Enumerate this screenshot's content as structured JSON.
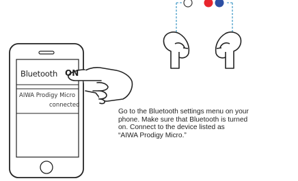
{
  "phone": {
    "bluetooth_label": "Bluetooth",
    "bluetooth_status": "ON",
    "device_name": "AIWA Prodigy Micro",
    "device_status": "connected"
  },
  "instructions": {
    "lines": [
      "Go to the Bluetooth settings menu on your",
      "phone.  Make sure that Bluetooth is turned",
      "on. Connect to the device listed as",
      "“AIWA Prodigy Micro.”"
    ]
  },
  "colors": {
    "red_led": "#e8252d",
    "blue_led": "#2d4fa3",
    "dashed_line": "#2a8ec0",
    "outline": "#222222"
  }
}
